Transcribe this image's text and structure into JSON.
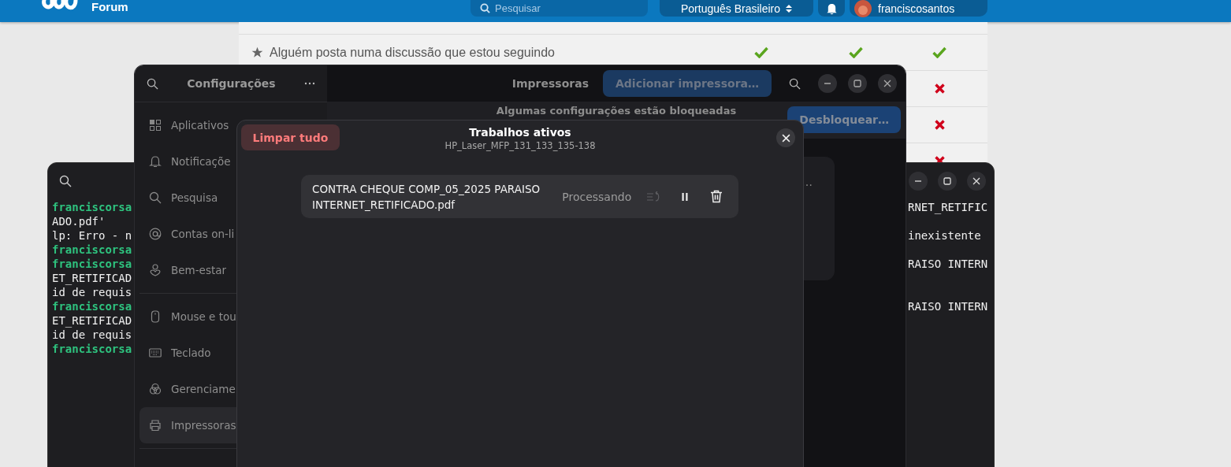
{
  "forum": {
    "logo_text": "Forum",
    "search": {
      "placeholder": "Pesquisar"
    },
    "language": "Português Brasileiro",
    "user": "franciscosantos",
    "rows": [
      {
        "label": "Alguém posta numa discussão que estou seguindo",
        "marks": [
          {
            "kind": "check"
          },
          {
            "kind": "check"
          },
          {
            "kind": "check"
          }
        ]
      },
      {
        "marks": [
          {
            "kind": "cross"
          }
        ]
      },
      {
        "marks": [
          {
            "kind": "cross"
          }
        ]
      },
      {
        "marks": [
          {
            "kind": "cross"
          }
        ]
      }
    ]
  },
  "terminal": {
    "lines": [
      {
        "left": "franciscorsa",
        "prompt": true,
        "right": "RNET_RETIFIC"
      },
      {
        "left": "ADO.pdf'",
        "prompt": false
      },
      {
        "left": "lp: Erro - n",
        "prompt": false,
        "right": "inexistente"
      },
      {
        "left": "franciscorsa",
        "prompt": true
      },
      {
        "left": "franciscorsa",
        "prompt": true,
        "right": "RAISO INTERN"
      },
      {
        "left": "ET_RETIFICAD",
        "prompt": false
      },
      {
        "left": "id de requis",
        "prompt": false
      },
      {
        "left": "franciscorsa",
        "prompt": true,
        "right": "RAISO INTERN"
      },
      {
        "left": "ET_RETIFICAD",
        "prompt": false
      },
      {
        "left": "id de requis",
        "prompt": false
      },
      {
        "left": "franciscorsa",
        "prompt": true
      }
    ]
  },
  "settings": {
    "title": "Configurações",
    "groups": [
      [
        {
          "label": "Aplicativos",
          "selected": false
        },
        {
          "label": "Notificaçõe",
          "selected": false
        },
        {
          "label": "Pesquisa",
          "selected": false
        },
        {
          "label": "Contas on-li",
          "selected": false
        },
        {
          "label": "Bem-estar",
          "selected": false
        }
      ],
      [
        {
          "label": "Mouse e tou",
          "selected": false
        },
        {
          "label": "Teclado",
          "selected": false
        },
        {
          "label": "Gerenciame",
          "selected": false
        },
        {
          "label": "Impressoras",
          "selected": true
        }
      ]
    ],
    "page_title": "Impressoras",
    "add_button": "Adicionar impressora…",
    "banner": {
      "text": "Algumas configurações estão bloqueadas",
      "button": "Desbloquear…"
    },
    "card_text": "…"
  },
  "dialog": {
    "clear_button": "Limpar tudo",
    "title": "Trabalhos ativos",
    "subtitle": "HP_Laser_MFP_131_133_135-138",
    "jobs": [
      {
        "name": "CONTRA CHEQUE COMP_05_2025 PARAISO INTERNET_RETIFICADO.pdf",
        "status": "Processando",
        "reorder_disabled": true
      }
    ]
  }
}
